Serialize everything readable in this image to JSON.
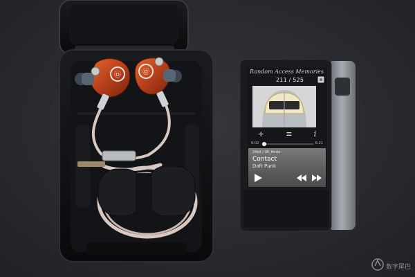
{
  "scene": {
    "colors": {
      "background": "#2a2c31",
      "iem_shell": "#c2461f",
      "case": "#0d0d0f",
      "cable": "#d9c8c2",
      "dap_body": "#1a1b1f",
      "dap_side": "#8e9297"
    }
  },
  "iem": {
    "brand_logo_text": "㉤"
  },
  "dap": {
    "logo_text": "Random Access Memories",
    "counter": "211 / 525",
    "toolbar": {
      "add_icon": "+",
      "menu_icon": "≡",
      "info_icon": "i"
    },
    "progress": {
      "elapsed": "0:02",
      "total": "6:21",
      "fraction": 0.02
    },
    "now_playing": {
      "format": "24bit / 96_Hertz",
      "title": "Contact",
      "artist": "Daft Punk"
    }
  },
  "watermark": {
    "text": "数字尾巴"
  }
}
